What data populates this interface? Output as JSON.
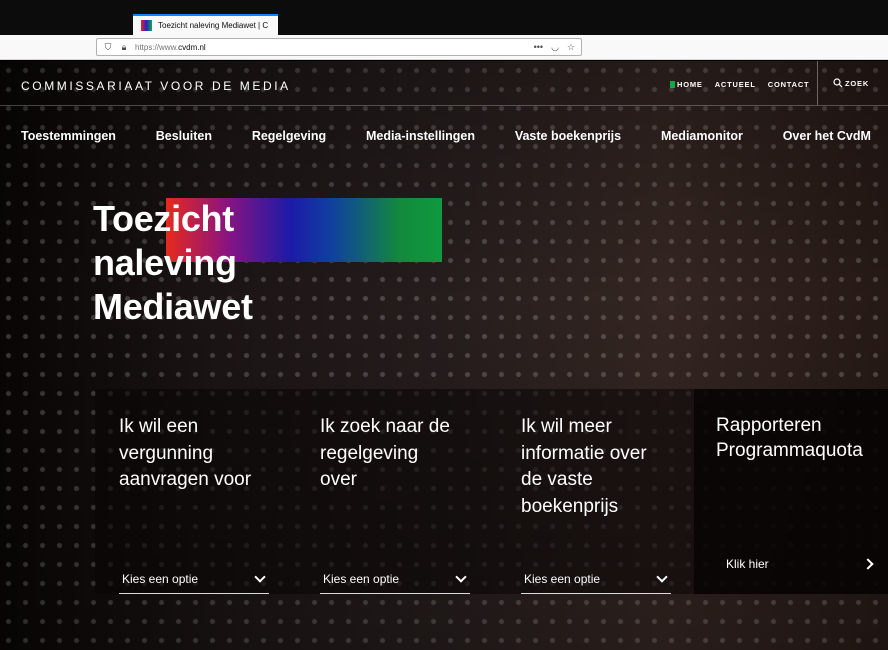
{
  "browser": {
    "tab_title": "Toezicht naleving Mediawet | C",
    "url_prefix": "https://www.",
    "url_domain": "cvdm.nl"
  },
  "header": {
    "brand": "COMMISSARIAAT VOOR DE MEDIA",
    "top_links": [
      "HOME",
      "ACTUEEL",
      "CONTACT"
    ],
    "search_label": "ZOEK"
  },
  "main_nav": [
    "Toestemmingen",
    "Besluiten",
    "Regelgeving",
    "Media-instellingen",
    "Vaste boekenprijs",
    "Mediamonitor",
    "Over het CvdM"
  ],
  "hero": {
    "title_lines": [
      "Toezicht",
      "naleving",
      "Mediawet"
    ]
  },
  "cards": [
    {
      "heading_lines": [
        "Ik wil een",
        "vergunning",
        "aanvragen voor"
      ],
      "select_placeholder": "Kies een optie"
    },
    {
      "heading_lines": [
        "Ik zoek naar de",
        "regelgeving",
        "over"
      ],
      "select_placeholder": "Kies een optie"
    },
    {
      "heading_lines": [
        "Ik wil meer",
        "informatie over",
        "de vaste",
        "boekenprijs"
      ],
      "select_placeholder": "Kies een optie"
    },
    {
      "heading_lines": [
        "Rapporteren",
        "Programmaquota"
      ],
      "link_label": "Klik hier"
    }
  ],
  "colors": {
    "accent_green": "#12a84a",
    "gradient": [
      "#e62a1e",
      "#1c1aa8",
      "#0e9a3e"
    ]
  }
}
